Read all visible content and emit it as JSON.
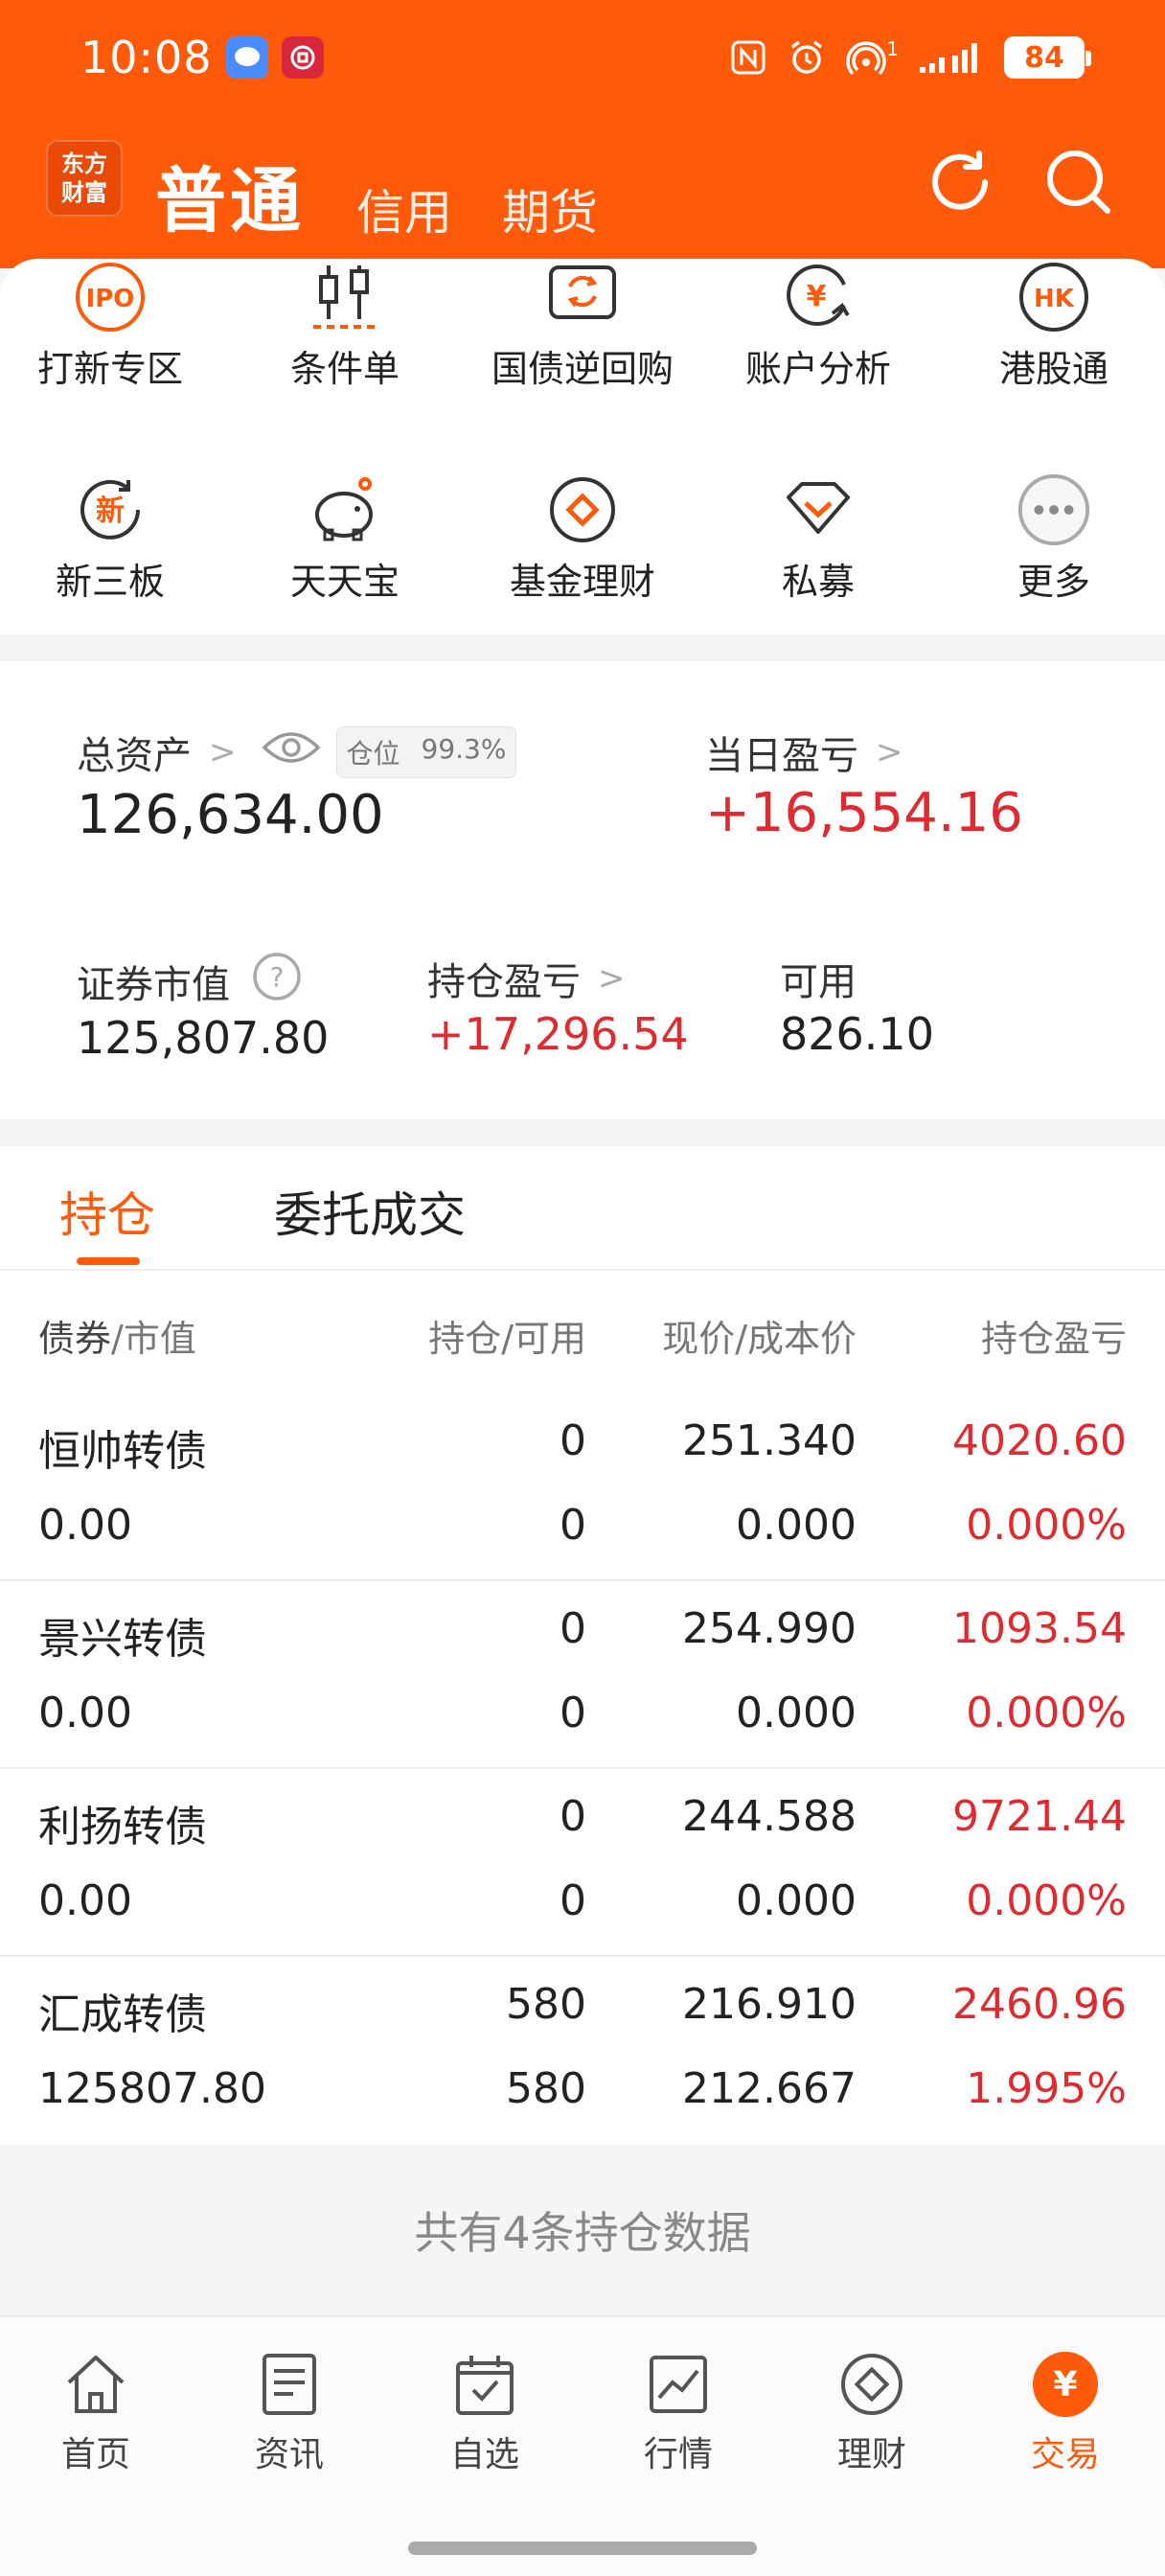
{
  "status_bar": {
    "time": "10:08",
    "battery": "84",
    "signal_super": "1"
  },
  "header": {
    "logo_line1": "东方",
    "logo_line2": "财富",
    "tabs": [
      {
        "label": "普通",
        "active": true
      },
      {
        "label": "信用",
        "active": false
      },
      {
        "label": "期货",
        "active": false
      }
    ],
    "refresh_icon": "refresh-icon",
    "search_icon": "search-icon"
  },
  "quick_menu": {
    "row1": [
      {
        "label": "打新专区",
        "icon": "ipo-icon",
        "icon_text": "IPO"
      },
      {
        "label": "条件单",
        "icon": "candlestick-icon"
      },
      {
        "label": "国债逆回购",
        "icon": "bond-repo-icon"
      },
      {
        "label": "账户分析",
        "icon": "yuan-chart-icon"
      },
      {
        "label": "港股通",
        "icon": "hk-icon",
        "icon_text": "HK"
      }
    ],
    "row2": [
      {
        "label": "新三板",
        "icon": "new-board-icon",
        "icon_text": "新"
      },
      {
        "label": "天天宝",
        "icon": "piggy-bank-icon"
      },
      {
        "label": "基金理财",
        "icon": "fund-icon"
      },
      {
        "label": "私募",
        "icon": "diamond-icon"
      },
      {
        "label": "更多",
        "icon": "more-icon"
      }
    ]
  },
  "assets": {
    "total_label": "总资产",
    "position_label": "仓位",
    "position_value": "99.3%",
    "total_value": "126,634.00",
    "daily_pnl_label": "当日盈亏",
    "daily_pnl_value": "+16,554.16",
    "market_value_label": "证券市值",
    "market_value": "125,807.80",
    "holding_pnl_label": "持仓盈亏",
    "holding_pnl_value": "+17,296.54",
    "available_label": "可用",
    "available_value": "826.10"
  },
  "holdings": {
    "tabs": [
      {
        "label": "持仓",
        "active": true
      },
      {
        "label": "委托成交",
        "active": false
      }
    ],
    "columns": {
      "name_a": "债券",
      "name_b": "/市值",
      "qty": "持仓/可用",
      "price": "现价/成本价",
      "pnl": "持仓盈亏"
    },
    "rows": [
      {
        "name": "恒帅转债",
        "market_value": "0.00",
        "position": "0",
        "available": "0",
        "price": "251.340",
        "cost": "0.000",
        "pnl": "4020.60",
        "pnl_pct": "0.000%"
      },
      {
        "name": "景兴转债",
        "market_value": "0.00",
        "position": "0",
        "available": "0",
        "price": "254.990",
        "cost": "0.000",
        "pnl": "1093.54",
        "pnl_pct": "0.000%"
      },
      {
        "name": "利扬转债",
        "market_value": "0.00",
        "position": "0",
        "available": "0",
        "price": "244.588",
        "cost": "0.000",
        "pnl": "9721.44",
        "pnl_pct": "0.000%"
      },
      {
        "name": "汇成转债",
        "market_value": "125807.80",
        "position": "580",
        "available": "580",
        "price": "216.910",
        "cost": "212.667",
        "pnl": "2460.96",
        "pnl_pct": "1.995%"
      }
    ],
    "footer": "共有4条持仓数据"
  },
  "bottom_nav": [
    {
      "label": "首页",
      "icon": "home-icon"
    },
    {
      "label": "资讯",
      "icon": "news-icon"
    },
    {
      "label": "自选",
      "icon": "watchlist-icon"
    },
    {
      "label": "行情",
      "icon": "market-icon"
    },
    {
      "label": "理财",
      "icon": "wealth-icon"
    },
    {
      "label": "交易",
      "icon": "trade-icon",
      "icon_text": "¥",
      "active": true
    }
  ],
  "colors": {
    "brand_orange": "#ff5a0a",
    "profit_red": "#e02a2f"
  }
}
